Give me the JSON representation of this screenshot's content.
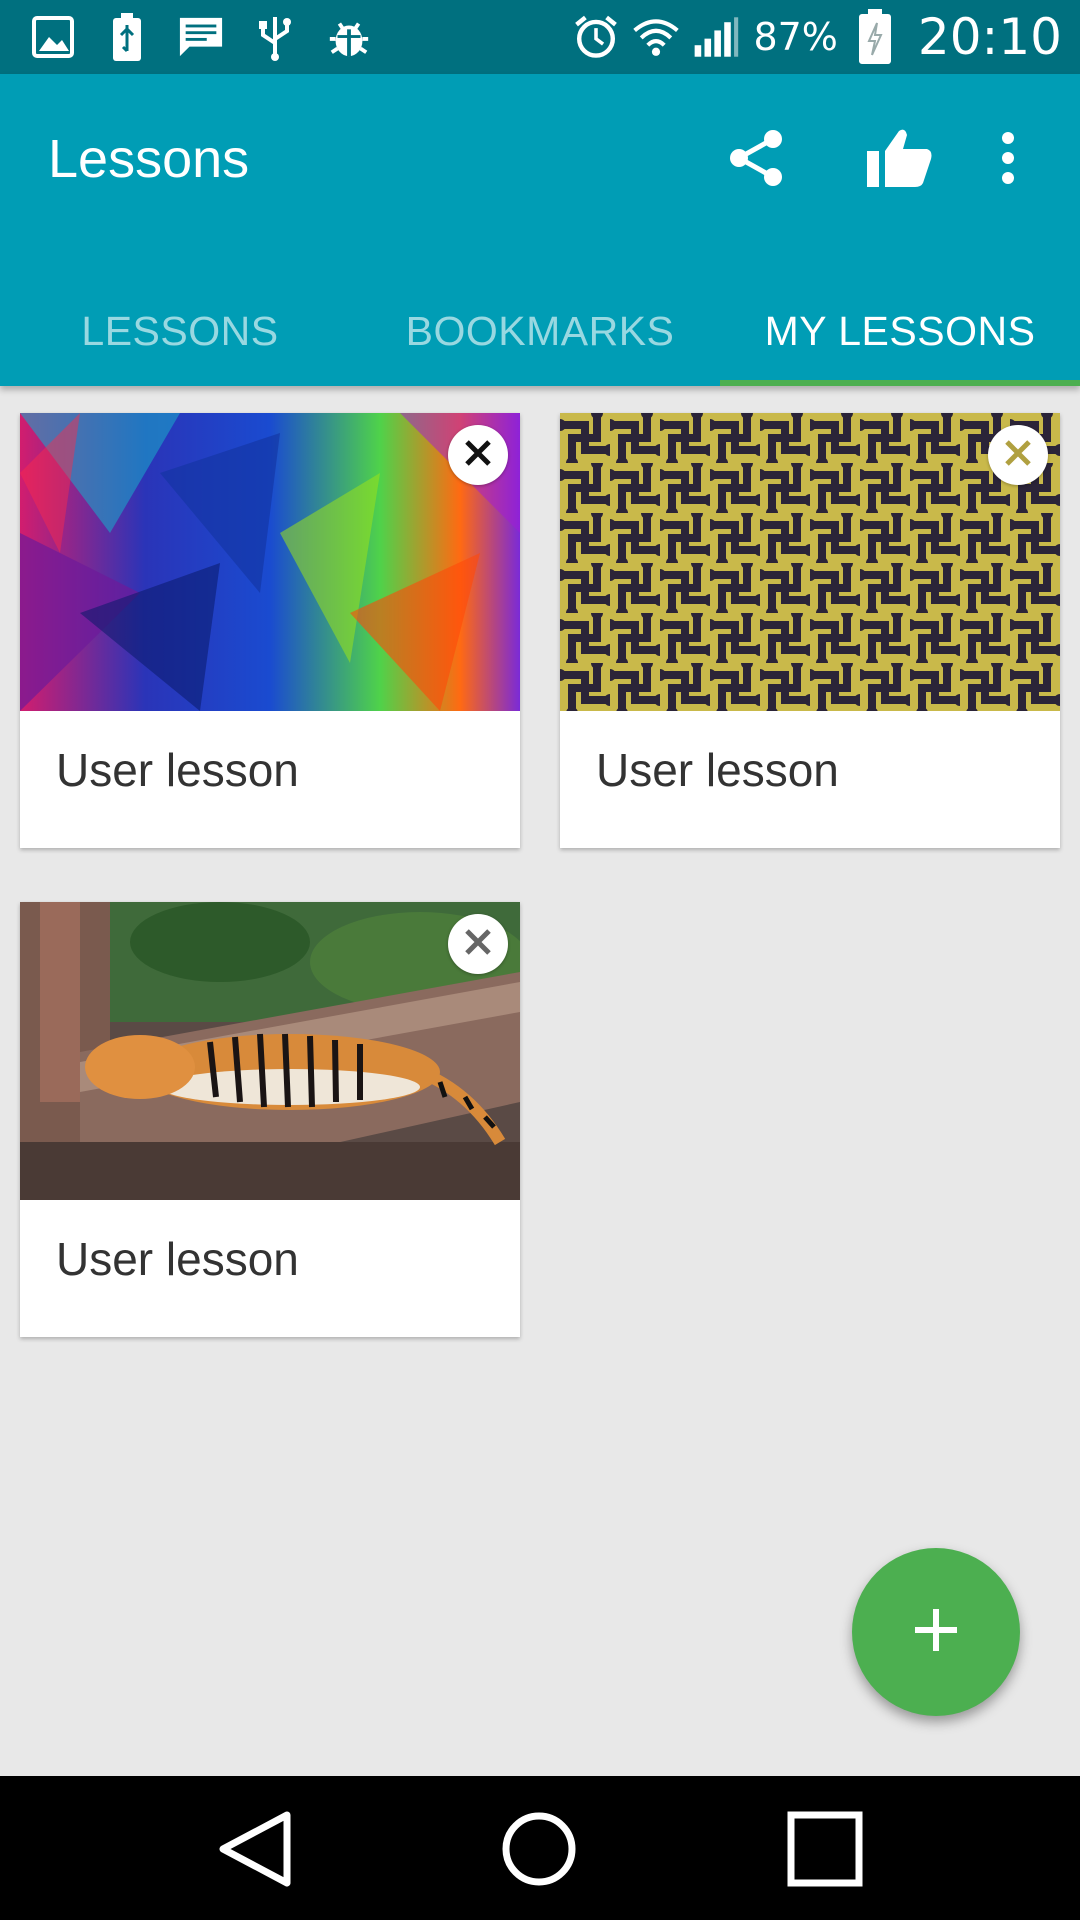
{
  "status_bar": {
    "battery_percent": "87%",
    "time": "20:10",
    "left_icons": [
      "image-icon",
      "battery-usb-icon",
      "message-icon",
      "usb-icon",
      "debug-icon"
    ],
    "right_icons": [
      "alarm-icon",
      "wifi-icon",
      "signal-icon",
      "battery-charging-icon"
    ]
  },
  "app_bar": {
    "title": "Lessons",
    "actions": [
      "share-icon",
      "thumb-up-icon",
      "more-vert-icon"
    ],
    "colors": {
      "primary": "#009db5",
      "primary_dark": "#00707f",
      "accent": "#4caf50"
    }
  },
  "tabs": [
    {
      "label": "LESSONS",
      "active": false
    },
    {
      "label": "BOOKMARKS",
      "active": false
    },
    {
      "label": "MY LESSONS",
      "active": true
    }
  ],
  "lessons": [
    {
      "label": "User lesson",
      "image": "colorful-polygon-abstract"
    },
    {
      "label": "User lesson",
      "image": "yellow-maze-pattern"
    },
    {
      "label": "User lesson",
      "image": "tiger-lying-on-wall"
    }
  ],
  "fab": {
    "icon": "plus-icon"
  },
  "nav_bar": {
    "buttons": [
      "back-icon",
      "home-icon",
      "recents-icon"
    ]
  }
}
